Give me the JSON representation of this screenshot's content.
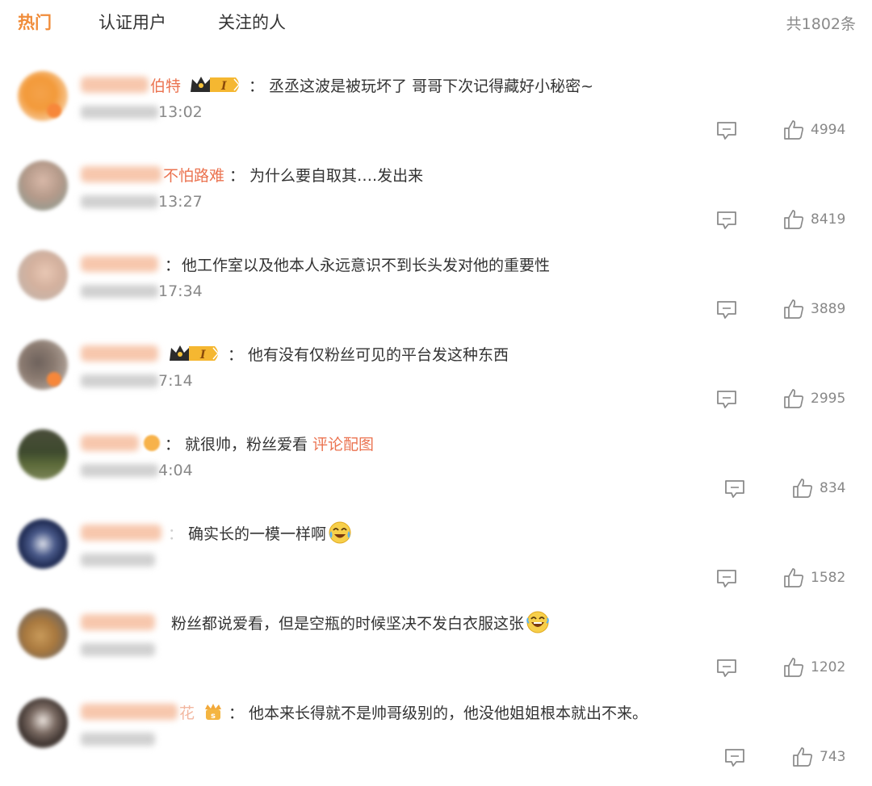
{
  "tabs": [
    {
      "label": "热门",
      "active": true
    },
    {
      "label": "认证用户",
      "active": false
    },
    {
      "label": "关注的人",
      "active": false
    }
  ],
  "total": "共1802条",
  "colors": {
    "accent": "#f08c3a",
    "username": "#eb7350",
    "muted": "#888888"
  },
  "comments": [
    {
      "name": "伯特",
      "text": "丞丞这波是被玩坏了 哥哥下次记得藏好小秘密~",
      "time": "13:02",
      "likes": "4994",
      "crown": true
    },
    {
      "name": "不怕路难",
      "text": "为什么要自取其….发出来",
      "time": "13:27",
      "likes": "8419",
      "crown": false
    },
    {
      "name": "",
      "text": "他工作室以及他本人永远意识不到长头发对他的重要性",
      "time": "17:34",
      "likes": "3889",
      "crown": false
    },
    {
      "name": "",
      "text": "他有没有仅粉丝可见的平台发这种东西",
      "time": "7:14",
      "likes": "2995",
      "crown": true
    },
    {
      "name": "",
      "text": "就很帅，粉丝爱看",
      "link": "评论配图",
      "time": "4:04",
      "likes": "834",
      "crown": false
    },
    {
      "name": "",
      "text": "确实长的一模一样啊",
      "time": "",
      "likes": "1582",
      "crown": false,
      "emoji": "cry-laugh"
    },
    {
      "name": "",
      "text": "粉丝都说爱看，但是空瓶的时候坚决不发白衣服这张",
      "time": "",
      "likes": "1202",
      "crown": false,
      "emoji": "laugh"
    },
    {
      "name": "花",
      "text": "他本来长得就不是帅哥级别的，他没他姐姐根本就出不来。",
      "time": "",
      "likes": "743",
      "crown": false
    }
  ]
}
